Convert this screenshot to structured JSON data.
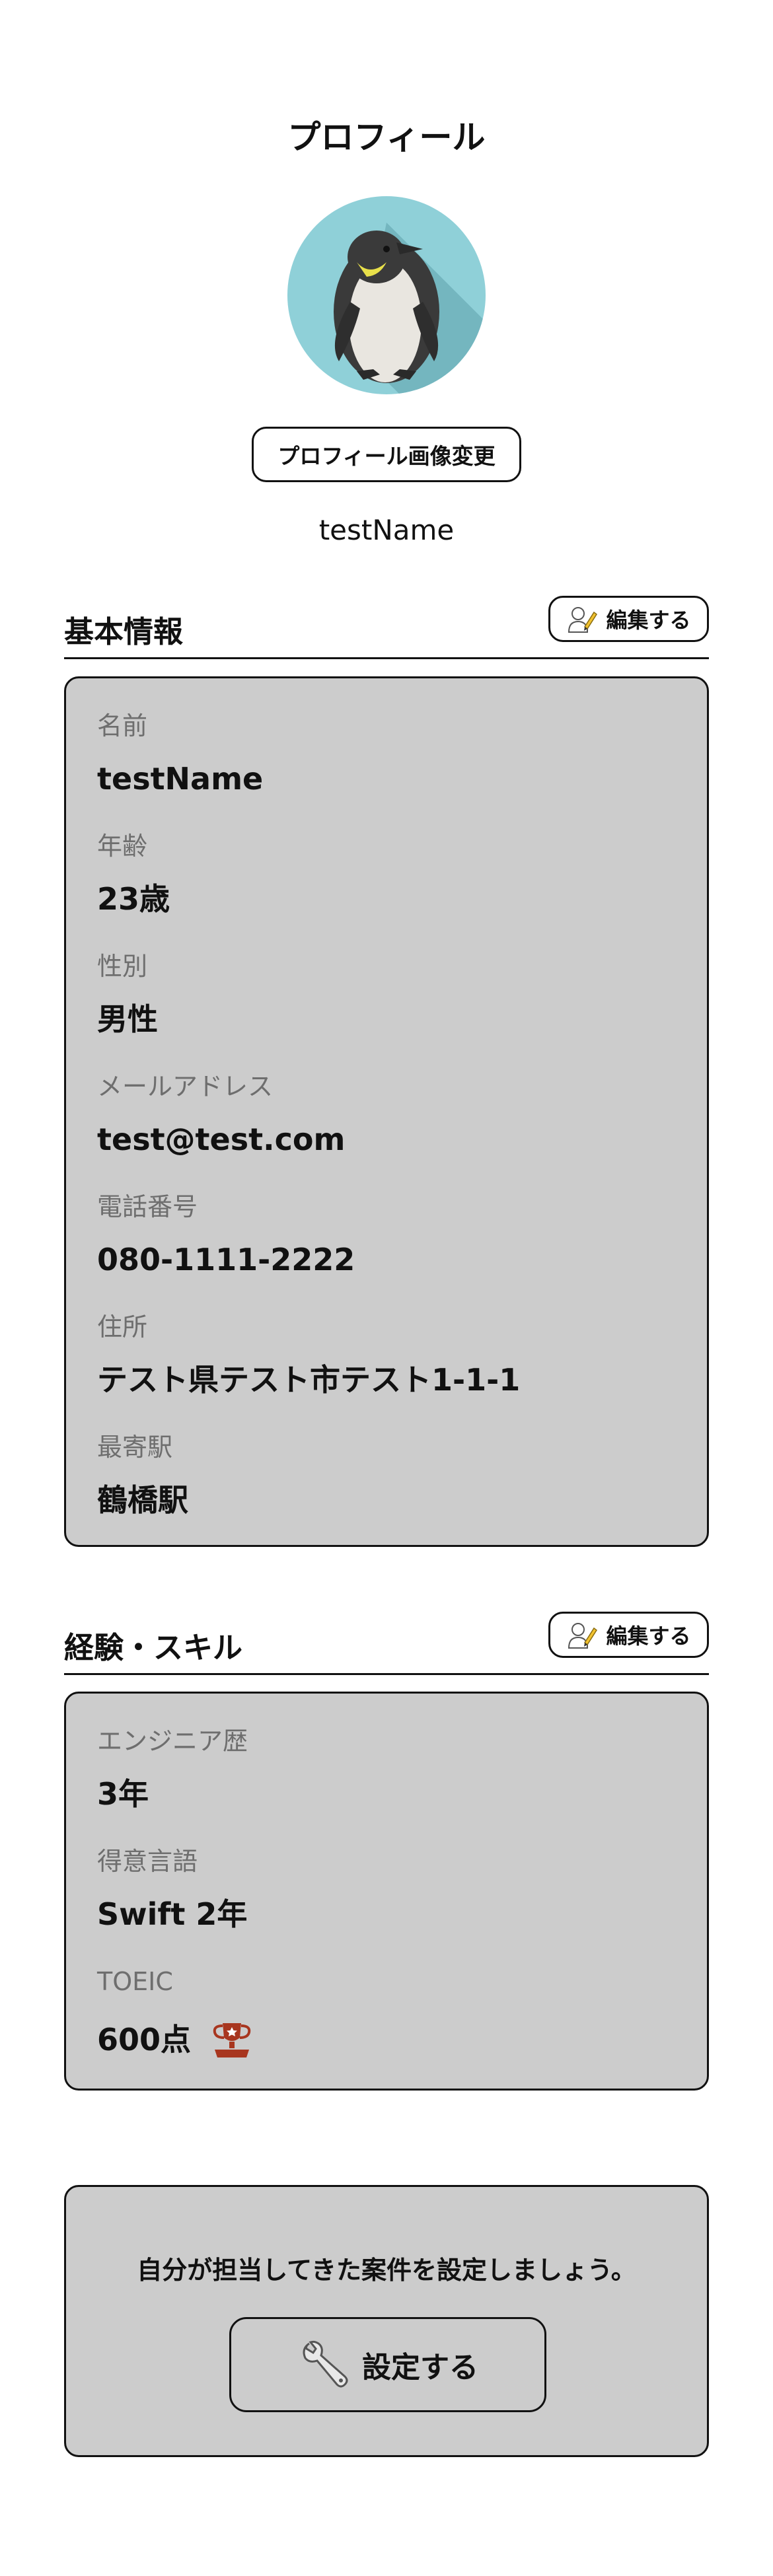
{
  "profile": {
    "title": "プロフィール",
    "avatar_icon": "penguin-avatar",
    "change_photo_label": "プロフィール画像変更",
    "user_name": "testName"
  },
  "basic_info": {
    "title": "基本情報",
    "edit_label": "編集する",
    "fields": [
      {
        "label": "名前",
        "value": "testName"
      },
      {
        "label": "年齢",
        "value": "23歳"
      },
      {
        "label": "性別",
        "value": "男性"
      },
      {
        "label": "メールアドレス",
        "value": "test@test.com"
      },
      {
        "label": "電話番号",
        "value": "080-1111-2222"
      },
      {
        "label": "住所",
        "value": "テスト県テスト市テスト1-1-1"
      },
      {
        "label": "最寄駅",
        "value": "鶴橋駅"
      }
    ]
  },
  "skills": {
    "title": "経験・スキル",
    "edit_label": "編集する",
    "fields": [
      {
        "label": "エンジニア歴",
        "value": "3年"
      },
      {
        "label": "得意言語",
        "value": "Swift  2年"
      },
      {
        "label": "TOEIC",
        "value": "600点",
        "badge_icon": "trophy-icon"
      }
    ]
  },
  "projects": {
    "message": "自分が担当してきた案件を設定しましょう。",
    "setup_label": "設定する",
    "setup_icon": "wrench-icon"
  },
  "colors": {
    "card_bg": "#cccccc",
    "avatar_bg": "#8fd0d8",
    "trophy": "#a8361f"
  }
}
